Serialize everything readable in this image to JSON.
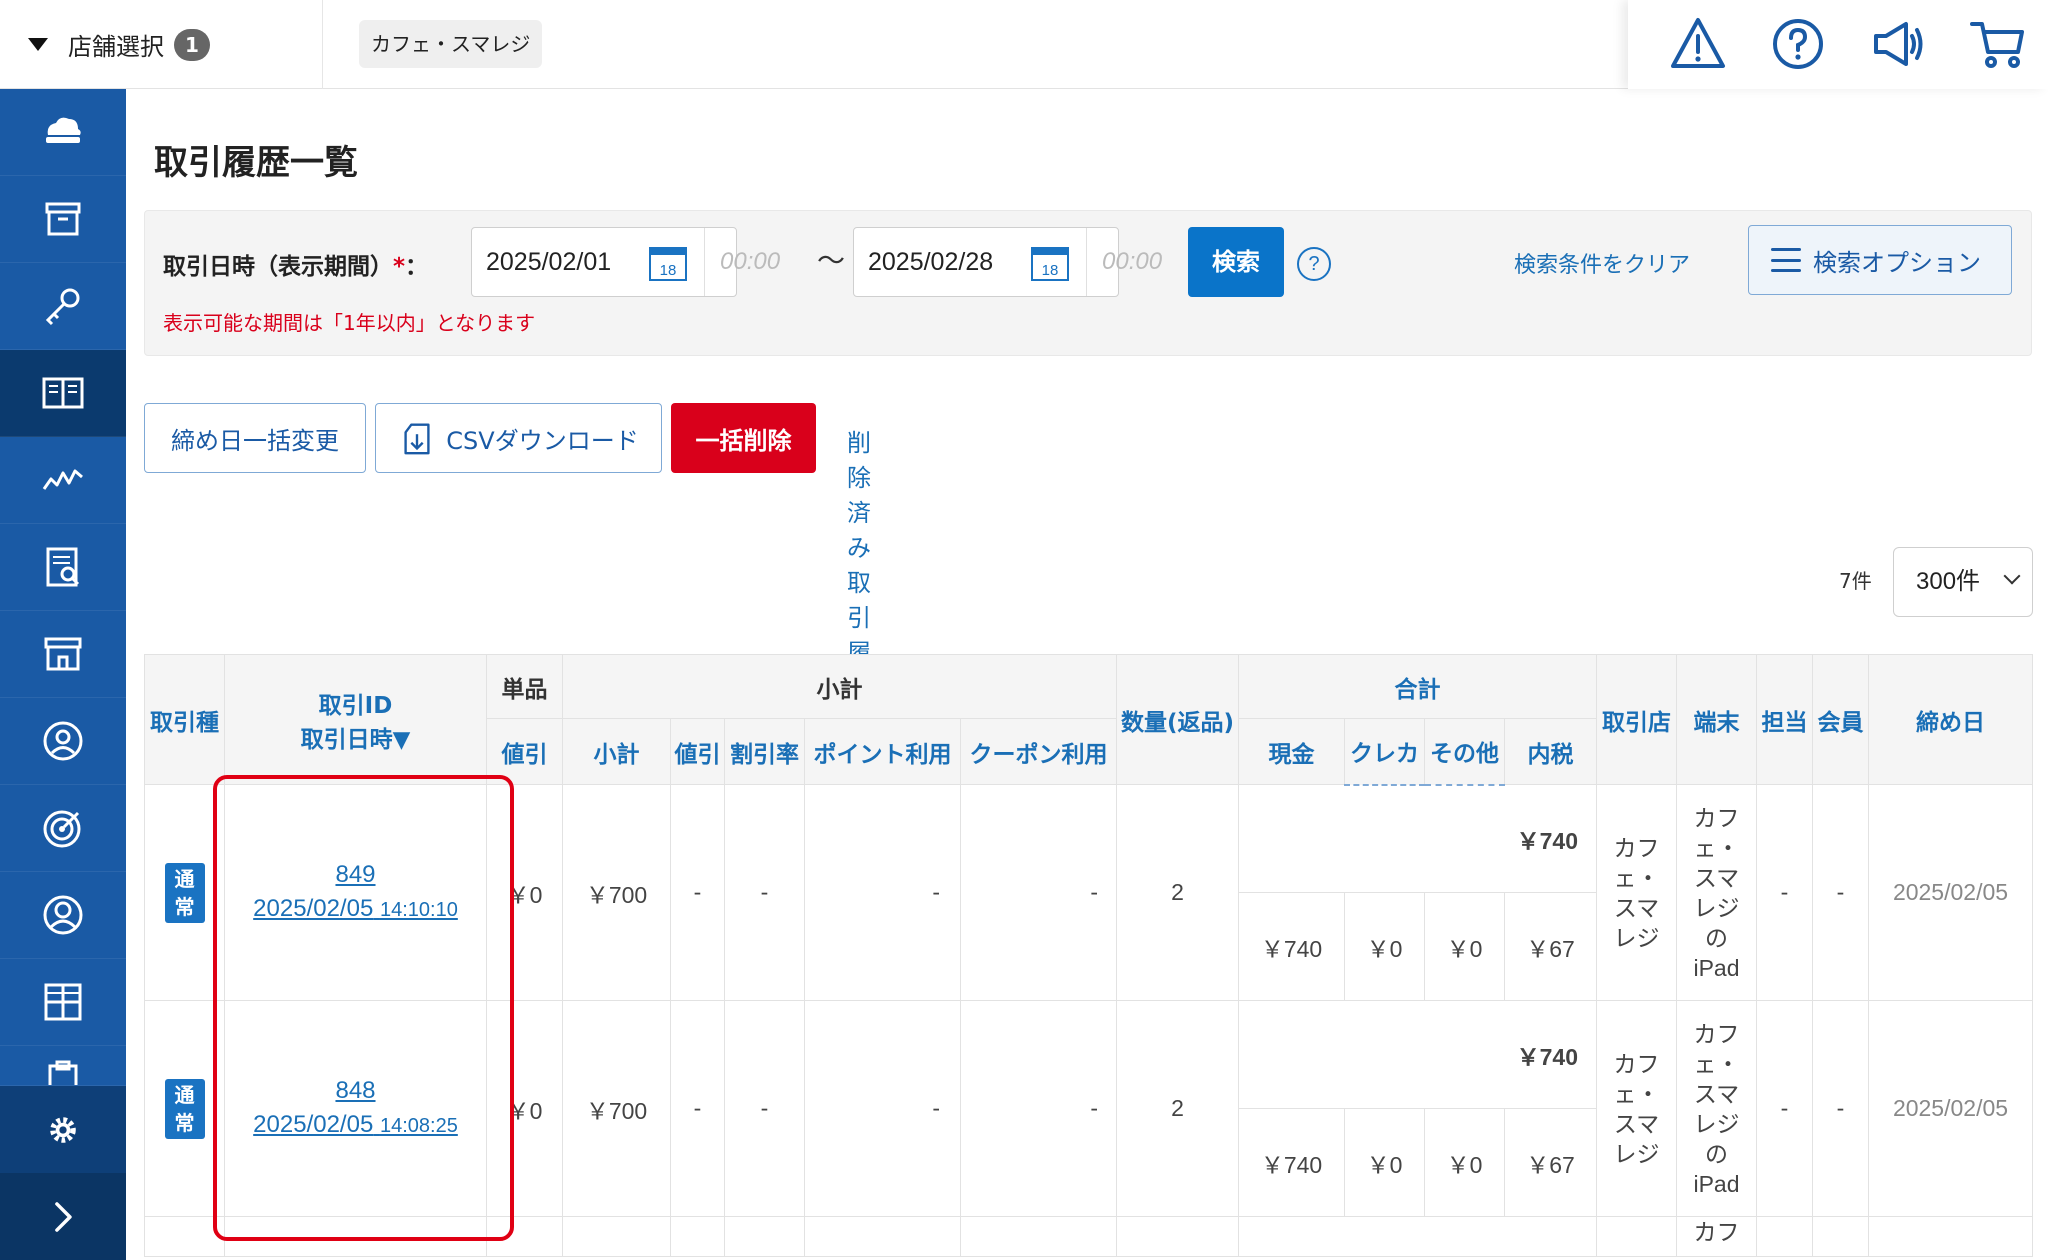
{
  "topbar": {
    "store_select_label": "店舗選択",
    "store_select_count": "1",
    "store_chip": "カフェ・スマレジ",
    "icons": [
      "warning-icon",
      "help-icon",
      "megaphone-icon",
      "cart-icon"
    ]
  },
  "sidebar": {
    "items": [
      "cloud-register-icon",
      "box-icon",
      "key-icon",
      "book-icon",
      "chart-icon",
      "report-icon",
      "store-icon",
      "customer-icon",
      "target-icon",
      "member-icon",
      "grid-icon",
      "clipboard-icon"
    ],
    "active_index": 3,
    "bottom": [
      "gear-icon",
      "expand-icon"
    ]
  },
  "page": {
    "title": "取引履歴一覧"
  },
  "search": {
    "label": "取引日時（表示期間）",
    "required_mark": "*",
    "colon": "：",
    "from_date": "2025/02/01",
    "from_time": "00:00",
    "to_date": "2025/02/28",
    "to_time": "00:00",
    "calendar_day": "18",
    "separator": "〜",
    "search_button": "検索",
    "help": "?",
    "note": "表示可能な期間は「1年以内」となります",
    "clear_link": "検索条件をクリア",
    "options_button": "検索オプション"
  },
  "actions": {
    "closing_change": "締め日一括変更",
    "csv_download": "CSVダウンロード",
    "bulk_delete": "一括削除",
    "deleted_history": "削除済み取引履歴一覧"
  },
  "listing": {
    "count": "7件",
    "page_size": "300件"
  },
  "table": {
    "headers": {
      "type": "取引種",
      "id_line1": "取引ID",
      "id_line2": "取引日時▼",
      "unit": "単品",
      "unit_discount": "値引",
      "subtotal_group": "小計",
      "subtotal": "小計",
      "sub_discount": "値引",
      "discount_rate": "割引率",
      "points": "ポイント利用",
      "coupon": "クーポン利用",
      "quantity": "数量(返品)",
      "total_group": "合計",
      "cash": "現金",
      "credit": "クレカ",
      "other": "その他",
      "tax": "内税",
      "store": "取引店",
      "terminal": "端末",
      "staff": "担当",
      "member": "会員",
      "closing": "締め日"
    },
    "rows": [
      {
        "type_top": "通",
        "type_bottom": "常",
        "id": "849",
        "date": "2025/02/05",
        "time": "14:10:10",
        "unit_discount": "￥0",
        "subtotal": "￥700",
        "sub_discount": "-",
        "discount_rate": "-",
        "points": "-",
        "coupon": "-",
        "quantity": "2",
        "total": "￥740",
        "cash": "￥740",
        "credit": "￥0",
        "other": "￥0",
        "tax": "￥67",
        "store_lines": [
          "カフ",
          "ェ・",
          "スマ",
          "レジ"
        ],
        "terminal_lines": [
          "カフ",
          "ェ・",
          "スマ",
          "レジ",
          "の",
          "iPad"
        ],
        "staff": "-",
        "member": "-",
        "closing": "2025/02/05"
      },
      {
        "type_top": "通",
        "type_bottom": "常",
        "id": "848",
        "date": "2025/02/05",
        "time": "14:08:25",
        "unit_discount": "￥0",
        "subtotal": "￥700",
        "sub_discount": "-",
        "discount_rate": "-",
        "points": "-",
        "coupon": "-",
        "quantity": "2",
        "total": "￥740",
        "cash": "￥740",
        "credit": "￥0",
        "other": "￥0",
        "tax": "￥67",
        "store_lines": [
          "カフ",
          "ェ・",
          "スマ",
          "レジ"
        ],
        "terminal_lines": [
          "カフ",
          "ェ・",
          "スマ",
          "レジ",
          "の",
          "iPad"
        ],
        "staff": "-",
        "member": "-",
        "closing": "2025/02/05"
      }
    ],
    "partial_row_text": "カフ"
  },
  "colors": {
    "sidebar": "#1a5aa5",
    "sidebar_active": "#0b3a6e",
    "primary": "#0a74c9",
    "danger": "#d9001b",
    "link": "#1a6fb6",
    "highlight": "#e00014"
  }
}
